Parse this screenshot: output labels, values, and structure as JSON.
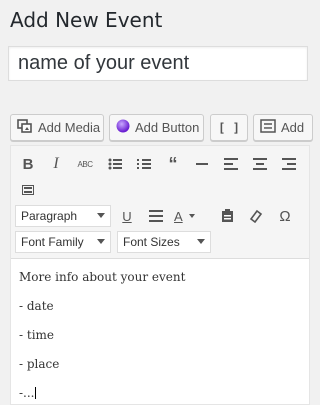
{
  "page": {
    "title": "Add New Event"
  },
  "title_field": {
    "value": "name of your event"
  },
  "media_buttons": [
    {
      "label": "Add Media",
      "icon": "add-media-icon"
    },
    {
      "label": "Add Button",
      "icon": "add-button-icon"
    },
    {
      "label": "",
      "icon": "shortcode-brackets-icon"
    },
    {
      "label": "Add",
      "icon": "add-form-icon"
    }
  ],
  "toolbar": {
    "row1": [
      "bold",
      "italic",
      "strikethrough",
      "bullet-list",
      "numbered-list",
      "blockquote",
      "horizontal-line",
      "align-left",
      "align-center",
      "align-right"
    ],
    "row2": [
      "kitchen-sink"
    ],
    "format_select": "Paragraph",
    "font_family_select": "Font Family",
    "font_sizes_select": "Font Sizes"
  },
  "content": {
    "lines": [
      "More info about your event",
      "- date",
      "- time",
      "- place",
      "-..."
    ]
  }
}
